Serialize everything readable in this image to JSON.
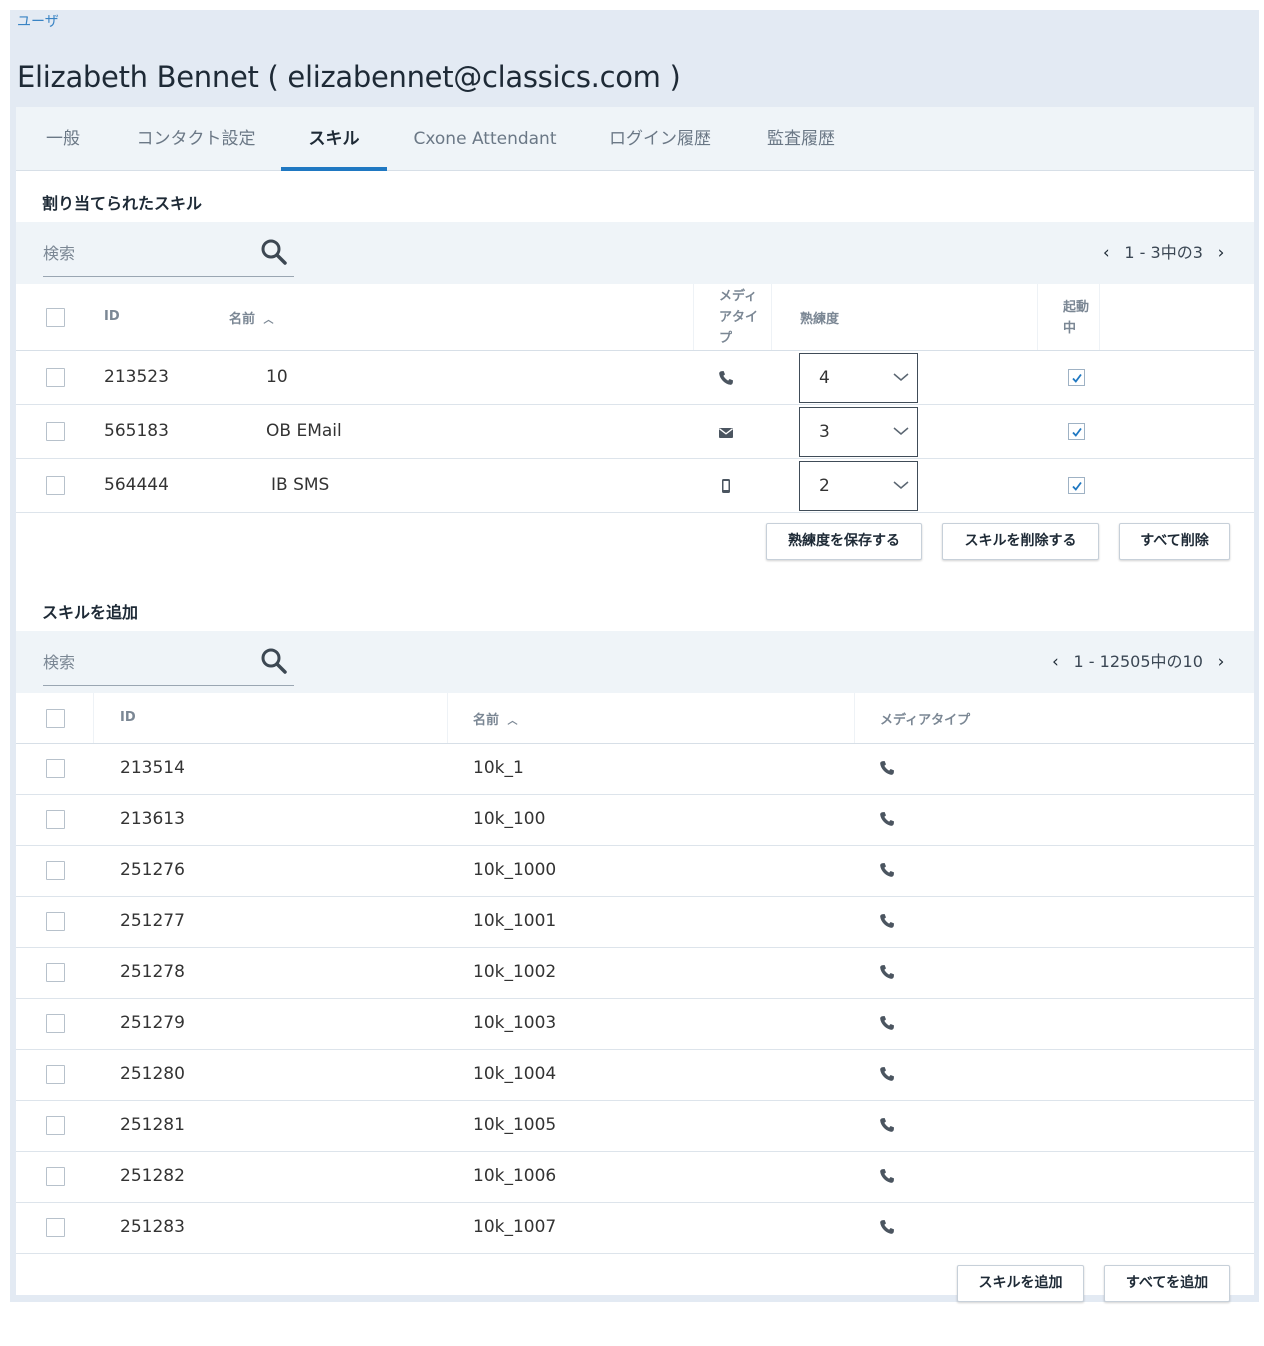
{
  "breadcrumb": "ユーザ",
  "page_title": "Elizabeth Bennet ( elizabennet@classics.com )",
  "tabs": [
    {
      "label": "一般"
    },
    {
      "label": "コンタクト設定"
    },
    {
      "label": "スキル",
      "active": true
    },
    {
      "label": "Cxone Attendant"
    },
    {
      "label": "ログイン履歴"
    },
    {
      "label": "監査履歴"
    }
  ],
  "assigned": {
    "title": "割り当てられたスキル",
    "search_placeholder": "検索",
    "pager": "1 - 3中の3",
    "headers": {
      "id": "ID",
      "name": "名前",
      "media": [
        "メディ",
        "アタイ",
        "プ"
      ],
      "proficiency": "熟練度",
      "active": [
        "起動",
        "中"
      ]
    },
    "rows": [
      {
        "id": "213523",
        "name": "10",
        "media": "phone-icon",
        "proficiency": "4",
        "active": true
      },
      {
        "id": "565183",
        "name": "OB EMail",
        "media": "email-icon",
        "proficiency": "3",
        "active": true
      },
      {
        "id": "564444",
        "name": "IB SMS",
        "media": "mobile-icon",
        "proficiency": "2",
        "active": true
      }
    ],
    "buttons": {
      "save": "熟練度を保存する",
      "delete": "スキルを削除する",
      "delete_all": "すべて削除"
    }
  },
  "add": {
    "title": "スキルを追加",
    "search_placeholder": "検索",
    "pager": "1 - 12505中の10",
    "headers": {
      "id": "ID",
      "name": "名前",
      "media": "メディアタイプ"
    },
    "rows": [
      {
        "id": "213514",
        "name": "10k_1",
        "media": "phone-icon"
      },
      {
        "id": "213613",
        "name": "10k_100",
        "media": "phone-icon"
      },
      {
        "id": "251276",
        "name": "10k_1000",
        "media": "phone-icon"
      },
      {
        "id": "251277",
        "name": "10k_1001",
        "media": "phone-icon"
      },
      {
        "id": "251278",
        "name": "10k_1002",
        "media": "phone-icon"
      },
      {
        "id": "251279",
        "name": "10k_1003",
        "media": "phone-icon"
      },
      {
        "id": "251280",
        "name": "10k_1004",
        "media": "phone-icon"
      },
      {
        "id": "251281",
        "name": "10k_1005",
        "media": "phone-icon"
      },
      {
        "id": "251282",
        "name": "10k_1006",
        "media": "phone-icon"
      },
      {
        "id": "251283",
        "name": "10k_1007",
        "media": "phone-icon"
      }
    ],
    "buttons": {
      "add": "スキルを追加",
      "add_all": "すべてを追加"
    }
  },
  "colors": {
    "accent": "#1f78c2",
    "link": "#3a84c4",
    "frame": "#e3eaf3",
    "toolbar": "#eff4f8"
  }
}
